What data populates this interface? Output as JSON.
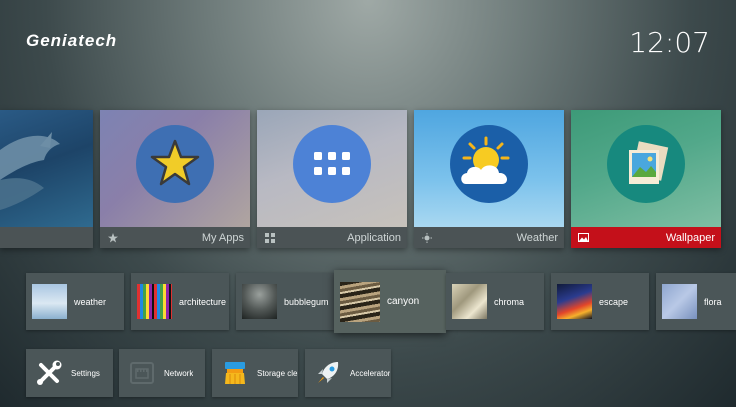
{
  "brand": {
    "logo": "Geniatech"
  },
  "status": {
    "time": "12:07"
  },
  "main_tiles": [
    {
      "label": ""
    },
    {
      "label": "My Apps"
    },
    {
      "label": "Application"
    },
    {
      "label": "Weather"
    },
    {
      "label": "Wallpaper"
    }
  ],
  "wallpapers": [
    {
      "label": "weather"
    },
    {
      "label": "architecture"
    },
    {
      "label": "bubblegum"
    },
    {
      "label": "canyon"
    },
    {
      "label": "chroma"
    },
    {
      "label": "escape"
    },
    {
      "label": "flora"
    }
  ],
  "apps": [
    {
      "label": "Settings"
    },
    {
      "label": "Network"
    },
    {
      "label": "Storage cle.."
    },
    {
      "label": "Accelerator"
    }
  ],
  "colors": {
    "accent": "#c4101a",
    "tile_bar": "#4b5355",
    "small_tile": "#4b5658"
  }
}
